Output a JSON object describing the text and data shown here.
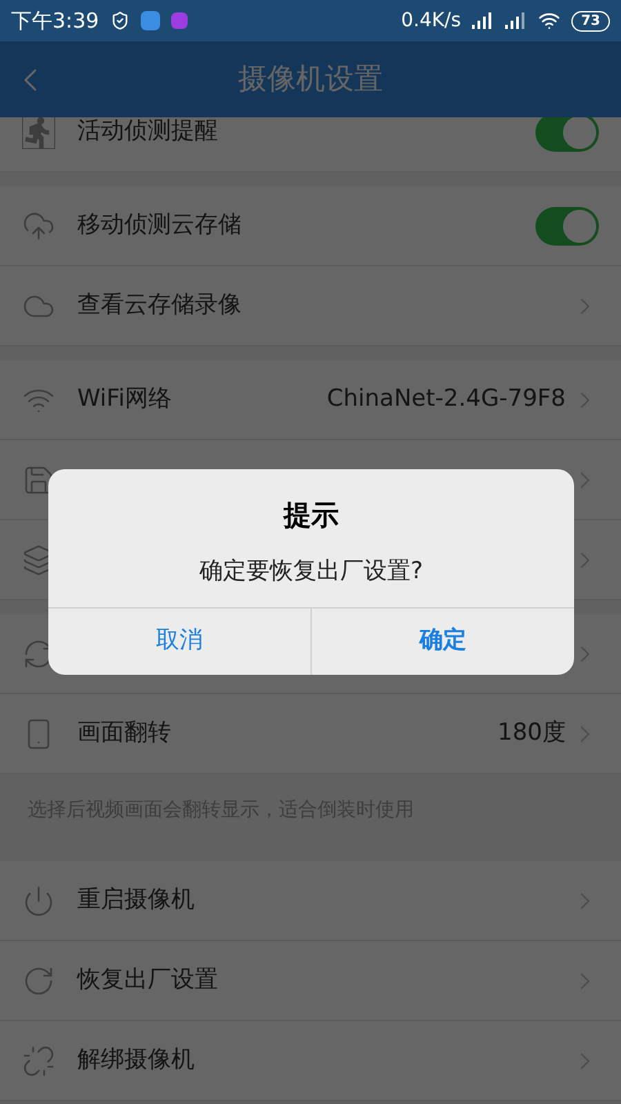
{
  "status_bar": {
    "time": "下午3:39",
    "speed": "0.4K/s",
    "battery": "73"
  },
  "header": {
    "title": "摄像机设置"
  },
  "sections": [
    {
      "rows": [
        {
          "kind": "toggle",
          "label": "活动侦测提醒",
          "on": true
        }
      ]
    },
    {
      "rows": [
        {
          "kind": "toggle",
          "label": "移动侦测云存储",
          "on": true
        },
        {
          "kind": "link",
          "label": "查看云存储录像"
        }
      ]
    },
    {
      "rows": [
        {
          "kind": "link",
          "label": "WiFi网络",
          "value": "ChinaNet-2.4G-79F8"
        },
        {
          "kind": "link"
        },
        {
          "kind": "link"
        }
      ]
    },
    {
      "rows": [
        {
          "kind": "link"
        },
        {
          "kind": "link",
          "label": "画面翻转",
          "value": "180度"
        }
      ],
      "note": "选择后视频画面会翻转显示，适合倒装时使用"
    },
    {
      "rows": [
        {
          "kind": "link",
          "label": "重启摄像机"
        },
        {
          "kind": "link",
          "label": "恢复出厂设置"
        },
        {
          "kind": "link",
          "label": "解绑摄像机"
        }
      ]
    }
  ],
  "dialog": {
    "title": "提示",
    "message": "确定要恢复出厂设置?",
    "buttons": [
      {
        "label": "取消",
        "primary": false
      },
      {
        "label": "确定",
        "primary": true
      }
    ]
  }
}
